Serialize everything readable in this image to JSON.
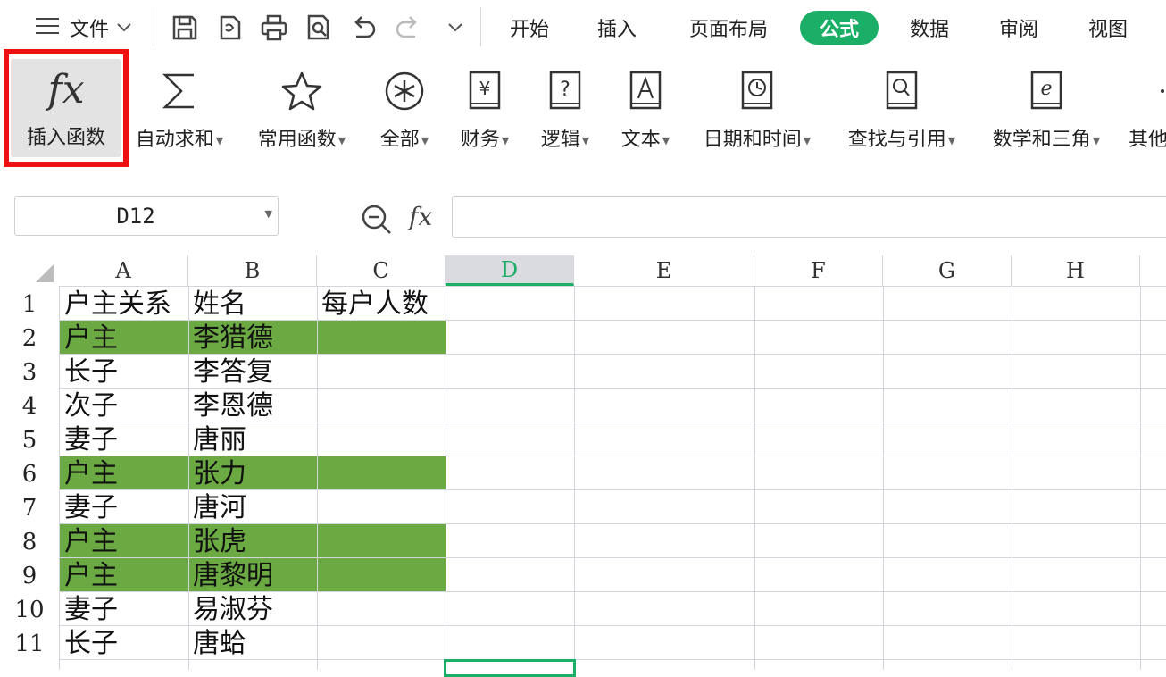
{
  "menubar": {
    "file_label": "文件",
    "tabs": [
      "开始",
      "插入",
      "页面布局",
      "公式",
      "数据",
      "审阅",
      "视图"
    ],
    "active_tab": "公式",
    "accent_color": "#1aae66"
  },
  "ribbon": {
    "buttons": [
      {
        "label": "插入函数",
        "icon": "fx-icon",
        "dropdown": false
      },
      {
        "label": "自动求和",
        "icon": "sigma-icon",
        "dropdown": true
      },
      {
        "label": "常用函数",
        "icon": "star-icon",
        "dropdown": true
      },
      {
        "label": "全部",
        "icon": "asterisk-icon",
        "dropdown": true
      },
      {
        "label": "财务",
        "icon": "yen-book-icon",
        "dropdown": true
      },
      {
        "label": "逻辑",
        "icon": "question-book-icon",
        "dropdown": true
      },
      {
        "label": "文本",
        "icon": "a-book-icon",
        "dropdown": true
      },
      {
        "label": "日期和时间",
        "icon": "clock-book-icon",
        "dropdown": true
      },
      {
        "label": "查找与引用",
        "icon": "magnifier-book-icon",
        "dropdown": true
      },
      {
        "label": "数学和三角",
        "icon": "e-book-icon",
        "dropdown": true
      },
      {
        "label": "其他",
        "icon": "more-icon",
        "dropdown": false
      }
    ],
    "highlight_color": "#ee1111"
  },
  "formulabar": {
    "namebox": "D12",
    "fx_label": "fx",
    "formula": ""
  },
  "sheet": {
    "columns": [
      "A",
      "B",
      "C",
      "D",
      "E",
      "F",
      "G",
      "H"
    ],
    "selected_column": "D",
    "rows": [
      {
        "num": "1",
        "a": "户主关系",
        "b": "姓名",
        "c": "每户人数",
        "highlight": false
      },
      {
        "num": "2",
        "a": "户主",
        "b": "李猎德",
        "c": "",
        "highlight": true
      },
      {
        "num": "3",
        "a": "长子",
        "b": "李答复",
        "c": "",
        "highlight": false
      },
      {
        "num": "4",
        "a": "次子",
        "b": "李恩德",
        "c": "",
        "highlight": false
      },
      {
        "num": "5",
        "a": "妻子",
        "b": "唐丽",
        "c": "",
        "highlight": false
      },
      {
        "num": "6",
        "a": "户主",
        "b": "张力",
        "c": "",
        "highlight": true
      },
      {
        "num": "7",
        "a": "妻子",
        "b": "唐河",
        "c": "",
        "highlight": false
      },
      {
        "num": "8",
        "a": "户主",
        "b": "张虎",
        "c": "",
        "highlight": true
      },
      {
        "num": "9",
        "a": "户主",
        "b": "唐黎明",
        "c": "",
        "highlight": true
      },
      {
        "num": "10",
        "a": "妻子",
        "b": "易淑芬",
        "c": "",
        "highlight": false
      },
      {
        "num": "11",
        "a": "长子",
        "b": "唐蛤",
        "c": "",
        "highlight": false
      }
    ],
    "highlight_color": "#6ba942"
  }
}
